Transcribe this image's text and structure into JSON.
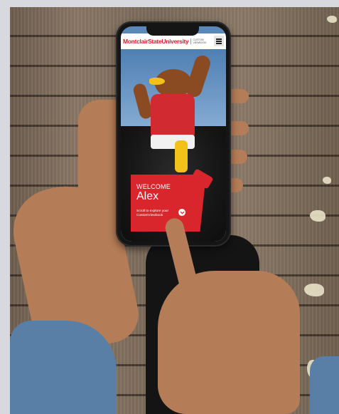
{
  "header": {
    "brand_name": "MontclairStateUniversity",
    "brand_subtitle": "CUSTOM VIEWBOOK"
  },
  "welcome": {
    "greeting": "WELCOME",
    "name": "Alex",
    "subtitle": "Scroll to explore your CustomViewbook"
  },
  "icons": {
    "menu": "hamburger-menu-icon",
    "scroll": "chevron-down-icon"
  },
  "colors": {
    "brand_red": "#d21f2a",
    "card_red": "#d9262c"
  }
}
